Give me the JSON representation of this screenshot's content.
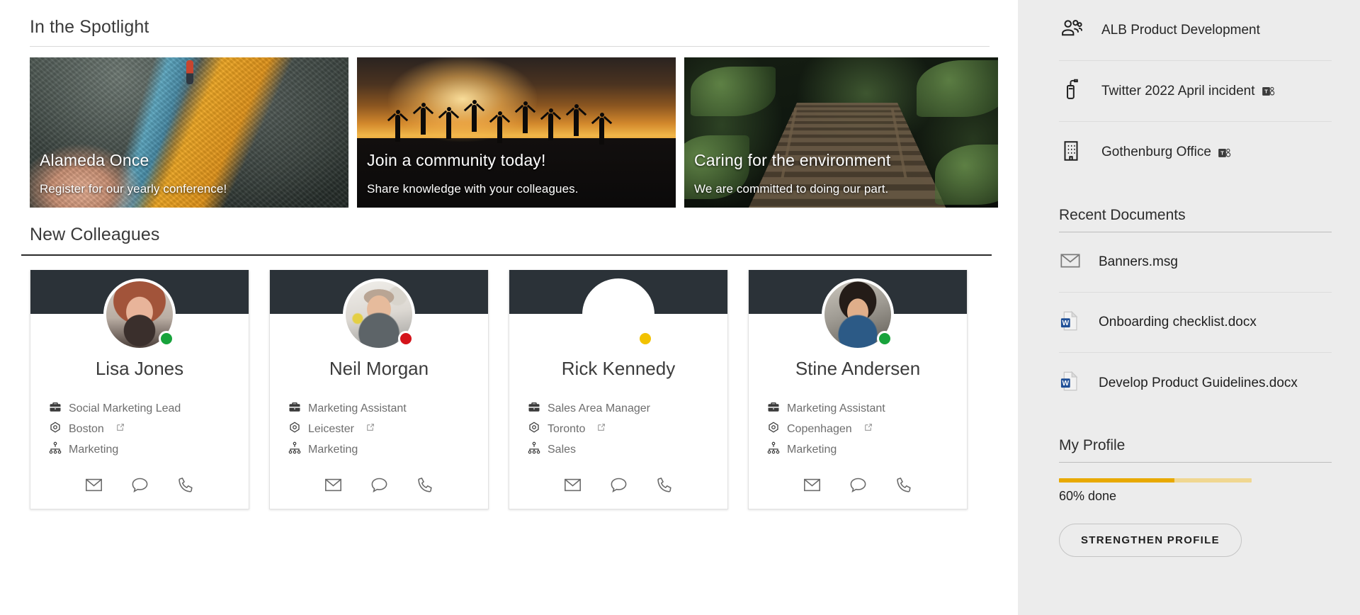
{
  "spotlight": {
    "heading": "In the Spotlight",
    "cards": [
      {
        "title": "Alameda Once",
        "subtitle": "Register for our yearly conference!",
        "image": "rocky-shore-kayak-photo"
      },
      {
        "title": "Join a community today!",
        "subtitle": "Share knowledge with your colleagues.",
        "image": "sunset-silhouettes-jumping-photo"
      },
      {
        "title": "Caring for the environment",
        "subtitle": "We are committed to doing our part.",
        "image": "forest-boardwalk-photo"
      }
    ]
  },
  "colleagues": {
    "heading": "New Colleagues",
    "cards": [
      {
        "name": "Lisa Jones",
        "title": "Social Marketing Lead",
        "location": "Boston",
        "department": "Marketing",
        "presence": "available",
        "presence_color": "#18a33c",
        "avatar": "lisa-jones-photo",
        "actions": [
          "email-icon",
          "chat-icon",
          "phone-icon"
        ]
      },
      {
        "name": "Neil Morgan",
        "title": "Marketing Assistant",
        "location": "Leicester",
        "department": "Marketing",
        "presence": "busy",
        "presence_color": "#d4131a",
        "avatar": "neil-morgan-photo",
        "actions": [
          "email-icon",
          "chat-icon",
          "phone-icon"
        ]
      },
      {
        "name": "Rick Kennedy",
        "title": "Sales Area Manager",
        "location": "Toronto",
        "department": "Sales",
        "presence": "away",
        "presence_color": "#f2c200",
        "avatar": "rick-kennedy-photo",
        "actions": [
          "email-icon",
          "chat-icon",
          "phone-icon"
        ]
      },
      {
        "name": "Stine Andersen",
        "title": "Marketing Assistant",
        "location": "Copenhagen",
        "department": "Marketing",
        "presence": "available",
        "presence_color": "#18a33c",
        "avatar": "stine-andersen-photo",
        "actions": [
          "email-icon",
          "chat-icon",
          "phone-icon"
        ]
      }
    ]
  },
  "sidebar": {
    "links": [
      {
        "label": "ALB Product Development",
        "icon": "people-group-icon",
        "badge": null
      },
      {
        "label": "Twitter 2022 April incident",
        "icon": "fire-extinguisher-icon",
        "badge": "teams-icon"
      },
      {
        "label": "Gothenburg Office",
        "icon": "office-building-icon",
        "badge": "teams-icon"
      }
    ],
    "recent_documents": {
      "heading": "Recent Documents",
      "items": [
        {
          "label": "Banners.msg",
          "icon": "outlook-message-icon"
        },
        {
          "label": "Onboarding checklist.docx",
          "icon": "word-document-icon"
        },
        {
          "label": "Develop Product Guidelines.docx",
          "icon": "word-document-icon"
        }
      ]
    },
    "profile": {
      "heading": "My Profile",
      "progress_percent": 60,
      "progress_label": "60% done",
      "button_label": "STRENGTHEN PROFILE",
      "progress_color": "#e8a900",
      "progress_track_color": "#f0d791"
    }
  }
}
